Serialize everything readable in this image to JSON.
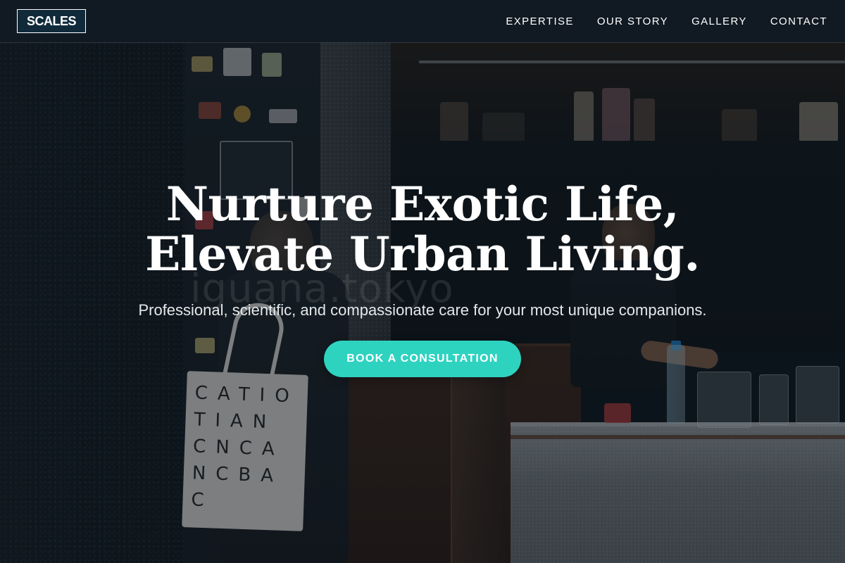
{
  "brand": {
    "logo_text": "SCALES",
    "accent_color": "#2ed3c0",
    "logo_bg_color": "#102a3a"
  },
  "nav": {
    "items": [
      {
        "label": "EXPERTISE"
      },
      {
        "label": "OUR STORY"
      },
      {
        "label": "GALLERY"
      },
      {
        "label": "CONTACT"
      }
    ]
  },
  "hero": {
    "title_line_1": "Nurture Exotic Life,",
    "title_line_2": "Elevate Urban Living.",
    "subtitle": "Professional, scientific, and compassionate care for your most unique companions.",
    "cta_label": "BOOK A CONSULTATION",
    "background_watermark": "iguana.tokyo",
    "tote_bag_letters": "CATIOTIANCNCANCBAC"
  }
}
